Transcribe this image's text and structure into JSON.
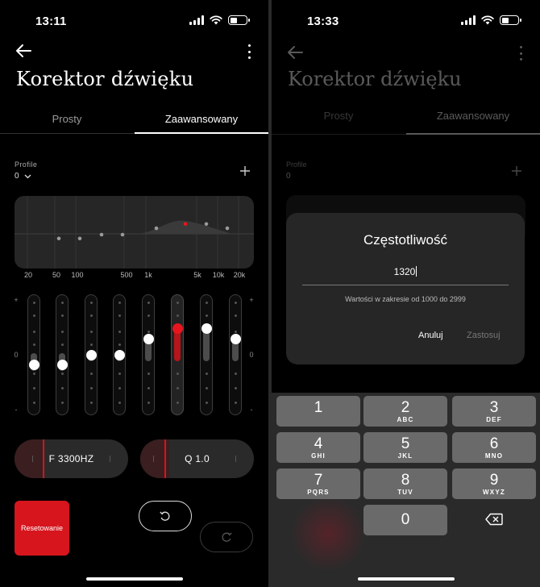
{
  "left": {
    "status": {
      "time": "13:11"
    },
    "title": "Korektor dźwięku",
    "tabs": [
      {
        "label": "Prosty"
      },
      {
        "label": "Zaawansowany"
      }
    ],
    "profile": {
      "label": "Profile",
      "value": "0"
    },
    "freq_labels": [
      "20",
      "50",
      "100",
      "500",
      "1k",
      "5k",
      "10k",
      "20k"
    ],
    "scale": {
      "plus": "+",
      "zero": "0",
      "minus": "-"
    },
    "bands": [
      {
        "gain": -0.2
      },
      {
        "gain": -0.2
      },
      {
        "gain": 0.0
      },
      {
        "gain": 0.0
      },
      {
        "gain": 0.33
      },
      {
        "gain": 0.55
      },
      {
        "gain": 0.55
      },
      {
        "gain": 0.33
      }
    ],
    "freq_pill": {
      "label": "F 3300HZ"
    },
    "q_pill": {
      "label": "Q 1.0"
    },
    "reset_label": "Resetowanie"
  },
  "right": {
    "status": {
      "time": "13:33"
    },
    "title": "Korektor dźwięku",
    "tabs": [
      {
        "label": "Prosty"
      },
      {
        "label": "Zaawansowany"
      }
    ],
    "profile": {
      "label": "Profile",
      "value": "0"
    },
    "dialog": {
      "title": "Częstotliwość",
      "value": "1320",
      "hint": "Wartości w zakresie od 1000 do 2999",
      "cancel": "Anuluj",
      "apply": "Zastosuj"
    },
    "keypad": [
      {
        "num": "1",
        "letters": ""
      },
      {
        "num": "2",
        "letters": "ABC"
      },
      {
        "num": "3",
        "letters": "DEF"
      },
      {
        "num": "4",
        "letters": "GHI"
      },
      {
        "num": "5",
        "letters": "JKL"
      },
      {
        "num": "6",
        "letters": "MNO"
      },
      {
        "num": "7",
        "letters": "PQRS"
      },
      {
        "num": "8",
        "letters": "TUV"
      },
      {
        "num": "9",
        "letters": "WXYZ"
      },
      {
        "num": "0",
        "letters": ""
      }
    ]
  },
  "colors": {
    "accent": "#e8151e",
    "background": "#000000",
    "surface": "#262626"
  }
}
